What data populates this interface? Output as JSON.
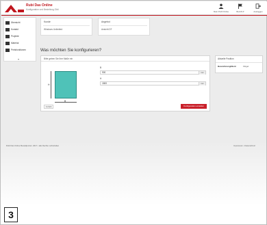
{
  "header": {
    "brand_title": "Rubi Das Online",
    "brand_subtitle": "Konfiguration und Bestellung Gbit",
    "actions": [
      {
        "label": "Mein Profil Online",
        "icon": "user-icon"
      },
      {
        "label": "Bericht ▾",
        "icon": "flag-icon"
      },
      {
        "label": "Ausloggen",
        "icon": "logout-icon"
      }
    ]
  },
  "sidebar": {
    "items": [
      {
        "label": "Übersicht",
        "icon": "home-icon"
      },
      {
        "label": "Kontakt",
        "icon": "users-icon"
      },
      {
        "label": "Projekte",
        "icon": "folder-icon"
      },
      {
        "label": "Material",
        "icon": "grid-icon"
      },
      {
        "label": "Preisfunktionen",
        "icon": "list-icon"
      }
    ],
    "more": "▾"
  },
  "cards": [
    {
      "title": "Kunde",
      "value": "Windows Unlimited"
    },
    {
      "title": "Angebot",
      "value": "Ansicht DT"
    }
  ],
  "question": "Was möchten Sie konfigurieren?",
  "panel": {
    "heading": "Bitte geben Sie Ihre Maße ein",
    "dim_width_label": "B",
    "dim_height_label": "H",
    "fields": [
      {
        "label": "B",
        "value": "900",
        "unit": "mm"
      },
      {
        "label": "H",
        "value": "1800",
        "unit": "mm"
      }
    ],
    "back_label": "zurück",
    "next_label": "Konfiguration erstellen"
  },
  "position_panel": {
    "title": "Aktuelle Position",
    "key": "Bezeichnung/Ident",
    "value": "Flügel"
  },
  "footer": {
    "left": "Rubi Das Online Bestellportal • 2017 • alle Rechte vorbehalten",
    "right": "Impressum • Datenschutz"
  },
  "step_number": "3",
  "colors": {
    "brand_red": "#c0161e",
    "shape_fill": "#4fc2b8"
  }
}
